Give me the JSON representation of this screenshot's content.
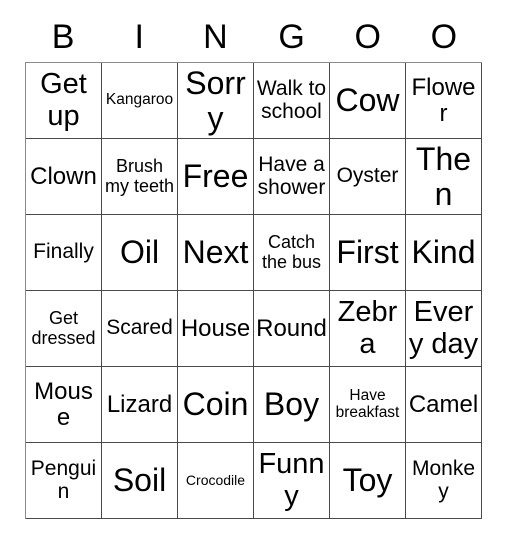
{
  "card": {
    "title": "BINGOO Card",
    "header_letters": [
      "B",
      "I",
      "N",
      "G",
      "O",
      "O"
    ],
    "columns": 6,
    "rows": 6,
    "colors": {
      "background": "#ffffff",
      "text": "#000000",
      "grid_line": "#4a4a4a",
      "outer_line": "#8a8a8a"
    },
    "cells": [
      [
        {
          "text": "Get up",
          "size": "xxl"
        },
        {
          "text": "Kangaroo",
          "size": "s"
        },
        {
          "text": "Sorry",
          "size": "h"
        },
        {
          "text": "Walk to school",
          "size": "l"
        },
        {
          "text": "Cow",
          "size": "h"
        },
        {
          "text": "Flower",
          "size": "xl"
        }
      ],
      [
        {
          "text": "Clown",
          "size": "xl"
        },
        {
          "text": "Brush my teeth",
          "size": "m"
        },
        {
          "text": "Free",
          "size": "h"
        },
        {
          "text": "Have a shower",
          "size": "l"
        },
        {
          "text": "Oyster",
          "size": "l"
        },
        {
          "text": "Then",
          "size": "h"
        }
      ],
      [
        {
          "text": "Finally",
          "size": "l"
        },
        {
          "text": "Oil",
          "size": "h"
        },
        {
          "text": "Next",
          "size": "h"
        },
        {
          "text": "Catch the bus",
          "size": "m"
        },
        {
          "text": "First",
          "size": "h"
        },
        {
          "text": "Kind",
          "size": "h"
        }
      ],
      [
        {
          "text": "Get dressed",
          "size": "m"
        },
        {
          "text": "Scared",
          "size": "l"
        },
        {
          "text": "House",
          "size": "xl"
        },
        {
          "text": "Round",
          "size": "xl"
        },
        {
          "text": "Zebra",
          "size": "xxl"
        },
        {
          "text": "Every day",
          "size": "xxl"
        }
      ],
      [
        {
          "text": "Mouse",
          "size": "xl"
        },
        {
          "text": "Lizard",
          "size": "xl"
        },
        {
          "text": "Coin",
          "size": "h"
        },
        {
          "text": "Boy",
          "size": "h"
        },
        {
          "text": "Have breakfast",
          "size": "s"
        },
        {
          "text": "Camel",
          "size": "xl"
        }
      ],
      [
        {
          "text": "Penguin",
          "size": "l"
        },
        {
          "text": "Soil",
          "size": "h"
        },
        {
          "text": "Crocodile",
          "size": "xs"
        },
        {
          "text": "Funny",
          "size": "xxl"
        },
        {
          "text": "Toy",
          "size": "h"
        },
        {
          "text": "Monkey",
          "size": "l"
        }
      ]
    ]
  }
}
